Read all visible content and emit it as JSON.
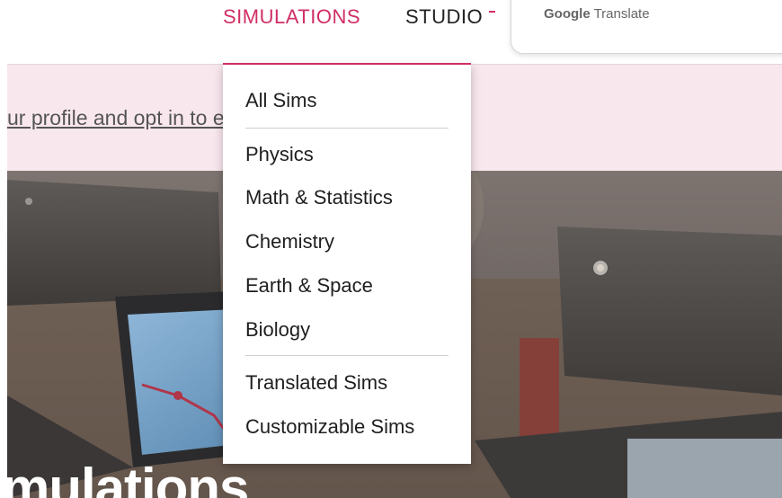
{
  "nav": {
    "simulations_label": "SIMULATIONS",
    "studio_label": "STUDIO",
    "google_label": "Google",
    "translate_label": "Translate"
  },
  "banner": {
    "text": "ur profile and opt in to emails."
  },
  "hero": {
    "title": "mulations"
  },
  "menu": {
    "items": [
      "All Sims",
      "Physics",
      "Math & Statistics",
      "Chemistry",
      "Earth & Space",
      "Biology",
      "Translated Sims",
      "Customizable Sims"
    ]
  },
  "colors": {
    "accent": "#d02f63",
    "banner_bg": "#f9e7ee"
  }
}
